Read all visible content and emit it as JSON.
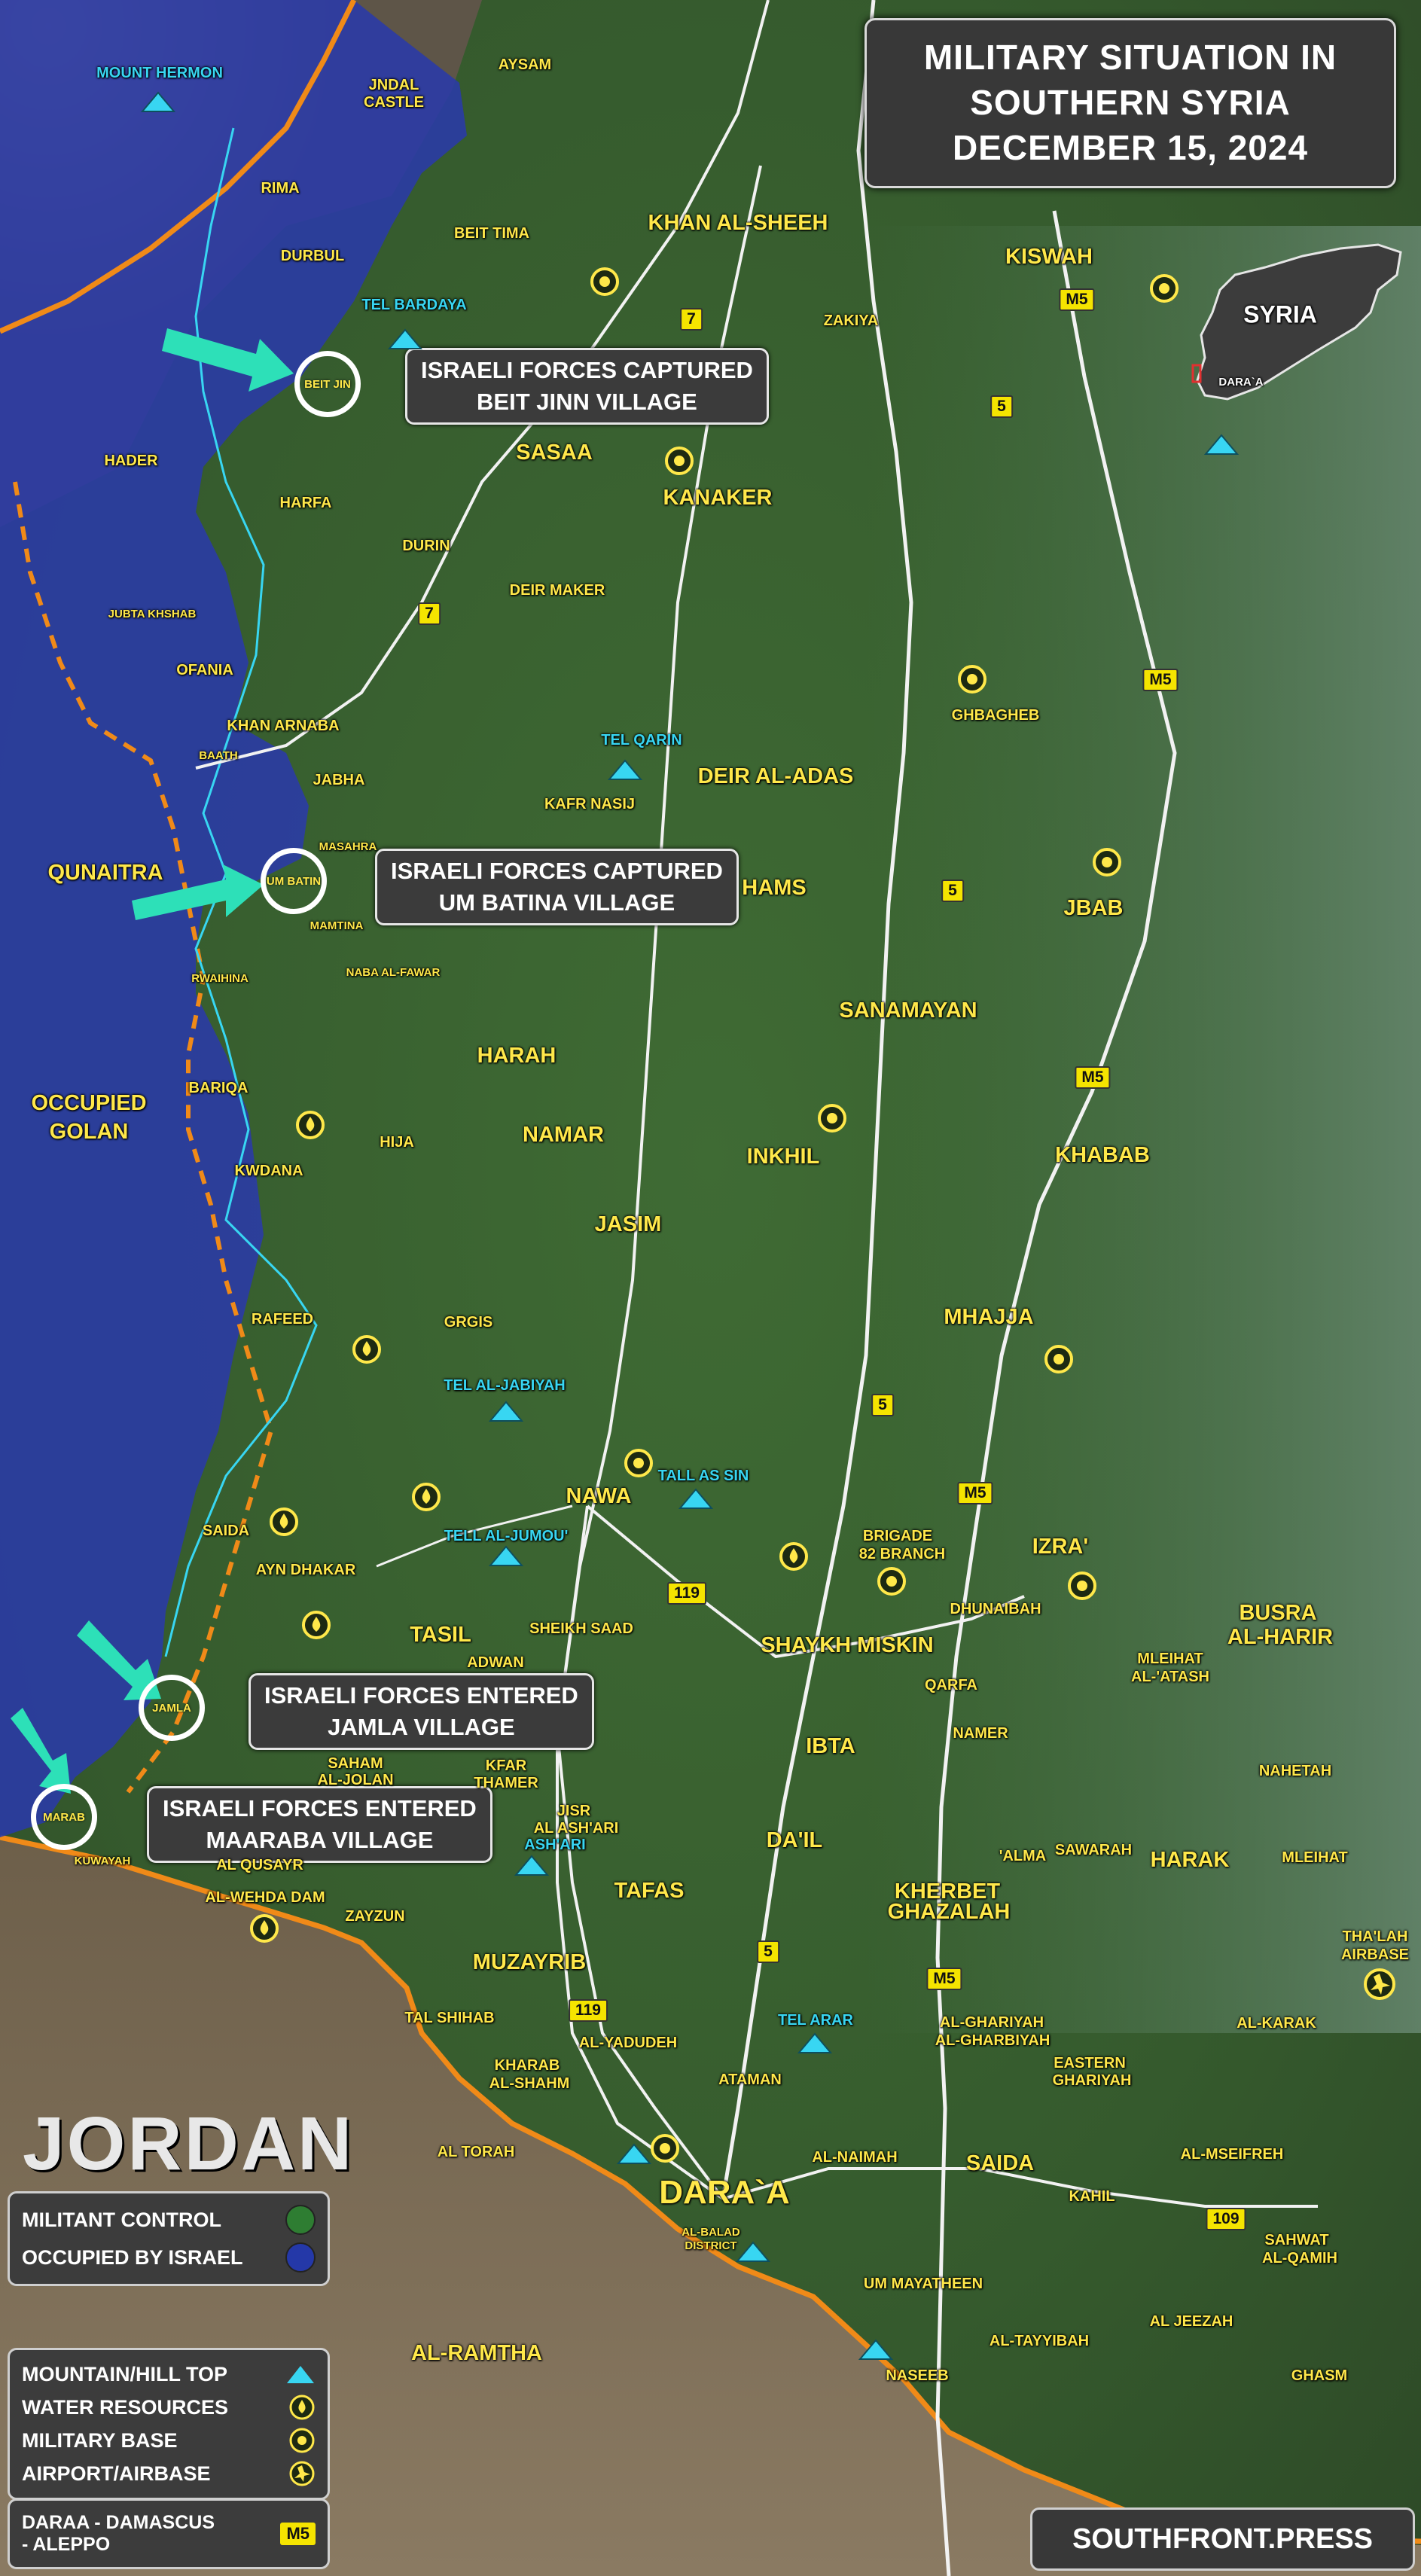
{
  "title": {
    "line1": "MILITARY SITUATION IN",
    "line2": "SOUTHERN SYRIA",
    "line3": "DECEMBER 15, 2024"
  },
  "colors": {
    "militant": "#2e7d32",
    "israel": "#2438a8",
    "accent": "#ffe84a",
    "water_label": "#38d6f2",
    "arrow": "#2de0b8",
    "border": "#f08a18"
  },
  "inset_map": {
    "country": "SYRIA",
    "region": "DARA`A"
  },
  "callouts": [
    {
      "id": "beit-jinn",
      "line1": "ISRAELI FORCES CAPTURED",
      "line2": "BEIT JINN VILLAGE",
      "ring_label": "BEIT JIN"
    },
    {
      "id": "um-batina",
      "line1": "ISRAELI FORCES CAPTURED",
      "line2": "UM BATINA VILLAGE",
      "ring_label": "UM BATIN"
    },
    {
      "id": "jamla",
      "line1": "ISRAELI FORCES ENTERED",
      "line2": "JAMLA VILLAGE",
      "ring_label": "JAMLA"
    },
    {
      "id": "maaraba",
      "line1": "ISRAELI FORCES ENTERED",
      "line2": "MAARABA VILLAGE",
      "ring_label": "MARAB"
    }
  ],
  "regions": {
    "quneitra": "QUNAITRA",
    "golan_line1": "OCCUPIED",
    "golan_line2": "GOLAN",
    "jordan": "JORDAN"
  },
  "place_labels": {
    "mount_hermon": "MOUNT HERMON",
    "aysam": "AYSAM",
    "jndal_castle_1": "JNDAL",
    "jndal_castle_2": "CASTLE",
    "khan_al_sheeh": "KHAN AL-SHEEH",
    "kiswah": "KISWAH",
    "rima": "RIMA",
    "durbul": "DURBUL",
    "beit_tima": "BEIT TIMA",
    "tel_bardaya": "TEL BARDAYA",
    "zakiya": "ZAKIYA",
    "sasaa": "SASAA",
    "kanaker": "KANAKER",
    "hader": "HADER",
    "harfa": "HARFA",
    "durin": "DURIN",
    "deir_maker": "DEIR MAKER",
    "jubta_khshab": "JUBTA KHSHAB",
    "ofania": "OFANIA",
    "ghbagheb": "GHBAGHEB",
    "khan_arnaba": "KHAN ARNABA",
    "baath": "BAATH",
    "tel_qarin": "TEL QARIN",
    "deir_al_adas": "DEIR AL-ADAS",
    "jabha": "JABHA",
    "kafr_nasij": "KAFR NASIJ",
    "masahra": "MASAHRA",
    "mamtina": "MAMTINA",
    "hams": "HAMS",
    "jbab": "JBAB",
    "rwaihina": "RWAIHINA",
    "naba_al_fawar": "NABA AL-FAWAR",
    "sanamayan": "SANAMAYAN",
    "harah": "HARAH",
    "bariqa": "BARIQA",
    "hija": "HIJA",
    "namar": "NAMAR",
    "inkhil": "INKHIL",
    "khabab": "KHABAB",
    "kwdana": "KWDANA",
    "jasim": "JASIM",
    "mhajja": "MHAJJA",
    "rafeed": "RAFEED",
    "grgis": "GRGIS",
    "tel_al_jabiyah": "TEL AL-JABIYAH",
    "nawa": "NAWA",
    "tall_as_sin": "TALL AS SIN",
    "saida_w": "SAIDA",
    "tell_al_jumou": "TELL AL-JUMOU'",
    "ayn_dhakar": "AYN DHAKAR",
    "brigade_1": "BRIGADE",
    "brigade_2": "82 BRANCH",
    "izra": "IZRA'",
    "dhunaibah": "DHUNAIBAH",
    "busra_1": "BUSRA",
    "busra_2": "AL-HARIR",
    "tasil": "TASIL",
    "sheikh_saad": "SHEIKH SAAD",
    "shaykh_miskin": "SHAYKH MISKIN",
    "adwan": "ADWAN",
    "qarfa": "QARFA",
    "mleihat_atash_1": "MLEIHAT",
    "mleihat_atash_2": "AL-'ATASH",
    "namer": "NAMER",
    "ibta": "IBTA",
    "saham_1": "SAHAM",
    "saham_2": "AL-JOLAN",
    "kfar_1": "KFAR",
    "kfar_2": "THAMER",
    "nahetah": "NAHETAH",
    "jisr_1": "JISR",
    "jisr_2": "AL ASH'ARI",
    "ashari": "ASH'ARI",
    "kuwayah": "KUWAYAH",
    "al_qusayr": "AL QUSAYR",
    "dail": "DA'IL",
    "alma": "'ALMA",
    "sawarah": "SAWARAH",
    "harak": "HARAK",
    "mleihat": "MLEIHAT",
    "wehda_dam": "AL-WEHDA DAM",
    "tafas": "TAFAS",
    "kherbet_1": "KHERBET",
    "kherbet_2": "GHAZALAH",
    "zayzun": "ZAYZUN",
    "thalah_1": "THA'LAH",
    "thalah_2": "AIRBASE",
    "muzayrib": "MUZAYRIB",
    "tal_shihab": "TAL SHIHAB",
    "tel_arar": "TEL ARAR",
    "ghariyah_1": "AL-GHARIYAH",
    "ghariyah_2": "AL-GHARBIYAH",
    "al_karak": "AL-KARAK",
    "al_yadudeh": "AL-YADUDEH",
    "kharab_1": "KHARAB",
    "kharab_2": "AL-SHAHM",
    "eastern_1": "EASTERN",
    "eastern_2": "GHARIYAH",
    "ataman": "ATAMAN",
    "al_torah": "AL TORAH",
    "al_naimah": "AL-NAIMAH",
    "saida_e": "SAIDA",
    "al_mseifreh": "AL-MSEIFREH",
    "daraa": "DARA`A",
    "kahil": "KAHIL",
    "al_balad_1": "AL-BALAD",
    "al_balad_2": "DISTRICT",
    "sahwat_1": "SAHWAT",
    "sahwat_2": "AL-QAMIH",
    "um_mayatheen": "UM MAYATHEEN",
    "al_jeezah": "AL JEEZAH",
    "al_tayyibah": "AL-TAYYIBAH",
    "al_ramtha": "AL-RAMTHA",
    "naseeb": "NASEEB",
    "ghasm": "GHASM"
  },
  "road_badges": [
    "7",
    "7",
    "5",
    "5",
    "5",
    "5",
    "119",
    "119",
    "109",
    "M5",
    "M5",
    "M5",
    "M5",
    "M5"
  ],
  "legend": {
    "militant_label": "MILITANT CONTROL",
    "israel_label": "OCCUPIED BY ISRAEL",
    "mountain_label": "MOUNTAIN/HILL TOP",
    "water_label": "WATER RESOURCES",
    "military_label": "MILITARY BASE",
    "airport_label": "AIRPORT/AIRBASE",
    "road_label_1": "DARAA - DAMASCUS",
    "road_label_2": "- ALEPPO",
    "road_badge": "M5"
  },
  "source": "SOUTHFRONT.PRESS"
}
